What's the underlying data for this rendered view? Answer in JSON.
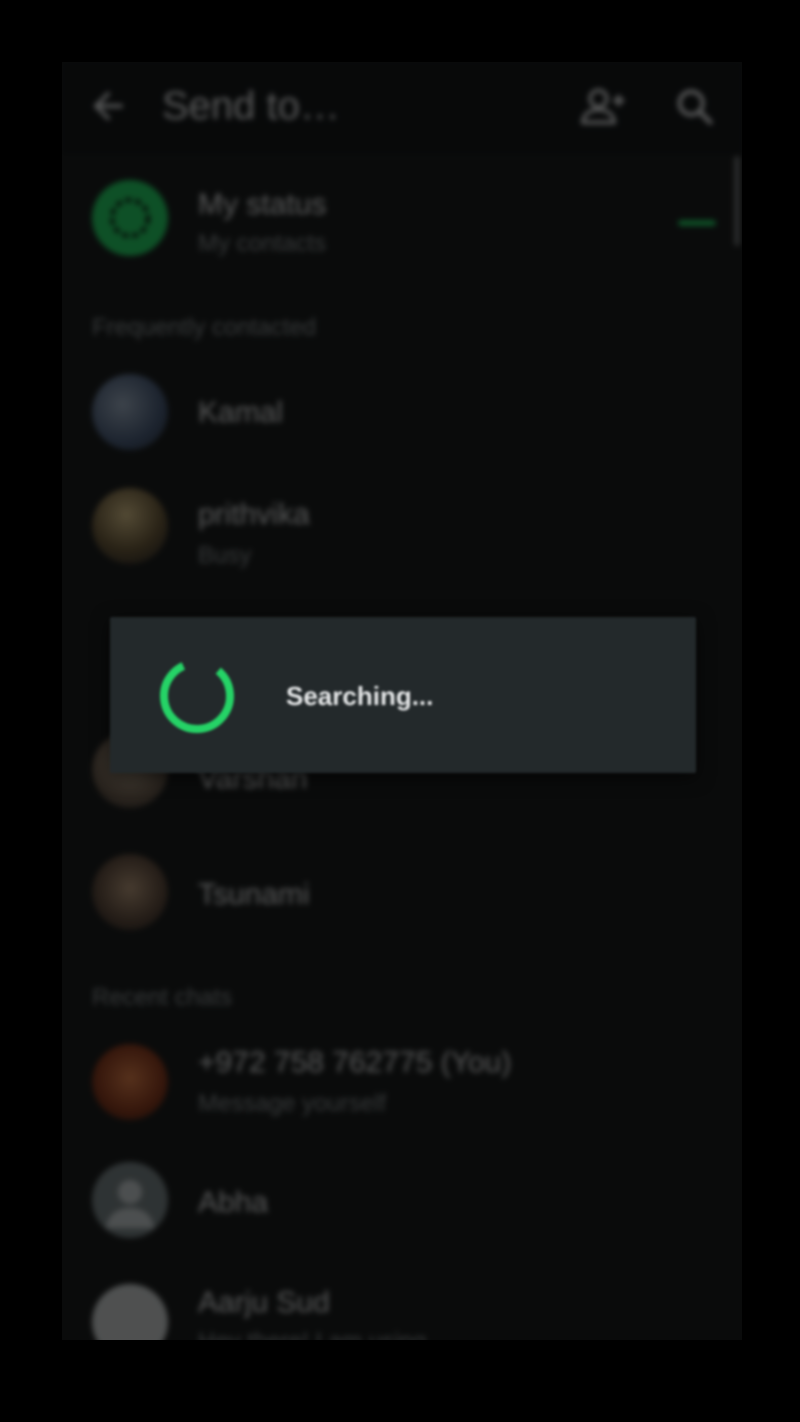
{
  "header": {
    "title": "Send to…",
    "back_icon": "arrow-left-icon",
    "add_contact_icon": "add-contact-icon",
    "search_icon": "search-icon"
  },
  "status": {
    "title": "My status",
    "subtitle": "My contacts"
  },
  "sections": {
    "frequent": "Frequently contacted",
    "recent": "Recent chats"
  },
  "frequent_contacts": [
    {
      "name": "Kamal",
      "subtitle": ""
    },
    {
      "name": "prithvika",
      "subtitle": "Busy"
    },
    {
      "name": "Varshan",
      "subtitle": ""
    },
    {
      "name": "Tsunami",
      "subtitle": ""
    }
  ],
  "recent_chats": [
    {
      "name": "+972 758 762775 (You)",
      "subtitle": "Message yourself"
    },
    {
      "name": "Abha",
      "subtitle": ""
    },
    {
      "name": "Aarju Sud",
      "subtitle": "Hey there! I am using"
    }
  ],
  "dialog": {
    "text": "Searching..."
  },
  "colors": {
    "accent": "#25d366",
    "background": "#0a0b0b",
    "dialog": "#23292b"
  }
}
